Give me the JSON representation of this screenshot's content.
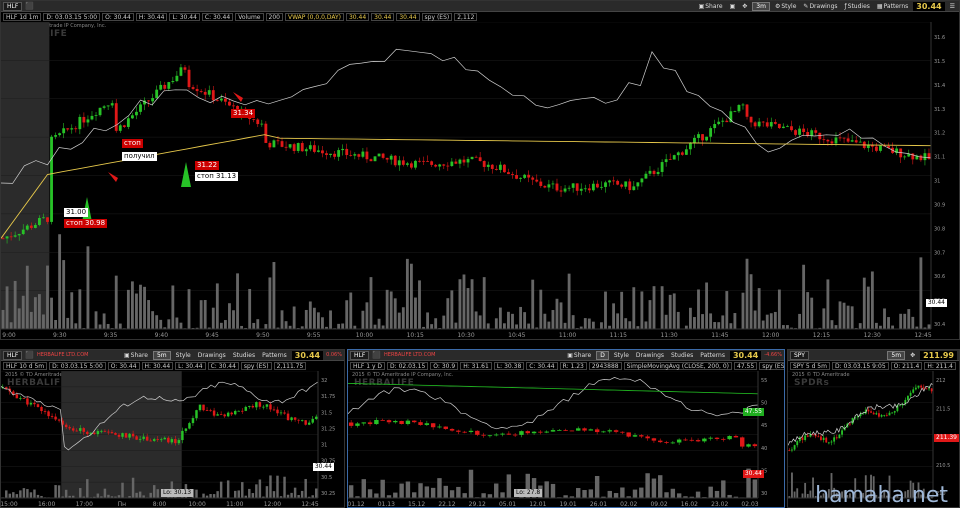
{
  "main": {
    "symbol": "HLF",
    "info": [
      "HLF 1d 1m",
      "D: 03.03.15 5:00",
      "O: 30.44",
      "H: 30.44",
      "L: 30.44",
      "C: 30.44",
      "Volume",
      "200",
      "VWAP (0,0,0,DAY)",
      "30.44",
      "30.44",
      "30.44",
      "spy (ES)",
      "2,112"
    ],
    "copyright": "2015 © TD Ameritrade IP Company, Inc.",
    "watermark": "HERBALIFE",
    "share": "Share",
    "timeframe": "3m",
    "style": "Style",
    "drawings": "Drawings",
    "studies": "Studies",
    "patterns": "Patterns",
    "last": "30.44",
    "x_labels": [
      "9:00",
      "9:30",
      "9:35",
      "9:40",
      "9:45",
      "9:50",
      "9:55",
      "10:00",
      "10:15",
      "10:30",
      "10:45",
      "11:00",
      "11:15",
      "11:30",
      "11:45",
      "12:00",
      "12:15",
      "12:30",
      "12:45"
    ],
    "y_labels": [
      "31.6",
      "31.5",
      "31.4",
      "31.3",
      "31.2",
      "31.1",
      "31",
      "30.9",
      "30.8",
      "30.7",
      "30.6",
      "30.5",
      "30.4"
    ],
    "annotations": {
      "a1": "31.00",
      "a2": "стоп 30.98",
      "a3": "стоп",
      "a4": "получил",
      "a5": "31.22",
      "a6": "стоп 31.13",
      "a7": "31.34"
    },
    "price_tag": "30.44"
  },
  "bottom_left": {
    "symbol": "HLF",
    "logo": "HERBALIFE LTD.COM",
    "share": "Share",
    "timeframe": "5m",
    "style": "Style",
    "drawings": "Drawings",
    "studies": "Studies",
    "patterns": "Patterns",
    "last": "30.44",
    "change": "0.06%",
    "info": [
      "HLF 10 d 5m",
      "D: 03.03.15 5:00",
      "O: 30.44",
      "H: 30.44",
      "L: 30.44",
      "C: 30.44",
      "spy (ES)",
      "2,111.75"
    ],
    "copyright": "2015 © TD Ameritrade IP Company, Inc.",
    "watermark": "HERBALIFE",
    "x_labels": [
      "15:00",
      "16:00",
      "17:00",
      "Пн",
      "8:00",
      "10:00",
      "11:00",
      "12:00",
      "12:45"
    ],
    "y_labels": [
      "32",
      "31.75",
      "31.5",
      "31.25",
      "31",
      "30.75",
      "30.5",
      "30.25"
    ],
    "lo_tag": "Lo: 30.13",
    "price_tag": "30.44"
  },
  "bottom_mid": {
    "symbol": "HLF",
    "logo": "HERBALIFE LTD.COM",
    "share": "Share",
    "timeframe": "D",
    "style": "Style",
    "drawings": "Drawings",
    "studies": "Studies",
    "patterns": "Patterns",
    "last": "30.44",
    "change": "-4.66%",
    "info": [
      "HLF 1 y D",
      "D: 02.03.15",
      "O: 30.9",
      "H: 31.61",
      "L: 30.38",
      "C: 30.44",
      "R: 1.23",
      "2943888",
      "SimpleMovingAvg (CLOSE, 200, 0)",
      "47.55",
      "spy (ES)",
      "2,114.25"
    ],
    "copyright": "2015 © TD Ameritrade IP Company, Inc.",
    "watermark": "HERBALIFE",
    "x_labels": [
      "01.12",
      "01.13",
      "15.12",
      "22.12",
      "29.12",
      "05.01",
      "12.01",
      "19.01",
      "26.01",
      "02.02",
      "09.02",
      "16.02",
      "23.02",
      "02.03"
    ],
    "y_labels": [
      "55",
      "50",
      "45",
      "40",
      "35",
      "30"
    ],
    "lo_tag": "Lo: 27.8",
    "sma_tag": "47.55",
    "price_tag": "30.44"
  },
  "bottom_right": {
    "symbol": "SPY",
    "timeframe": "5m",
    "last": "211.99",
    "info": [
      "SPY 5 d 5m",
      "D: 03.03.15 9:05",
      "O: 211.4",
      "H: 211.4"
    ],
    "copyright": "2015 © TD Ameritrade",
    "watermark": "SPDRs",
    "y_labels": [
      "212",
      "211.5",
      "211",
      "210.5",
      "210"
    ],
    "price_tag": "211.39"
  },
  "site_watermark": "hamaha.net",
  "colors": {
    "up": "#27c227",
    "down": "#e01818",
    "vwap": "#e6c84b",
    "sma": "#1fae1f",
    "compare": "#cfcfcf",
    "volume": "#666666"
  }
}
